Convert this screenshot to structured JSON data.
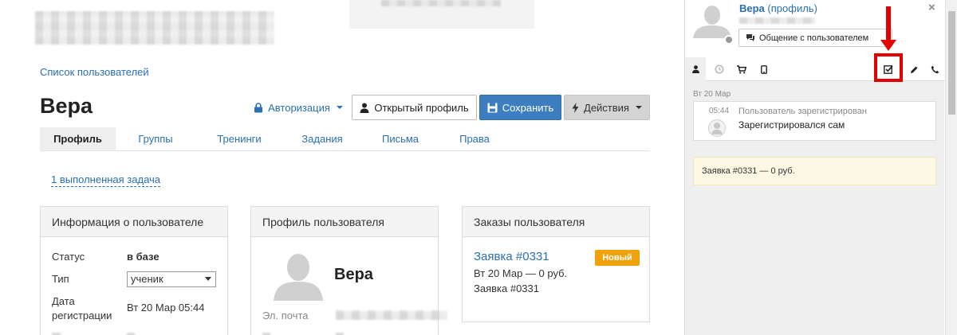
{
  "main": {
    "breadcrumb": "Список пользователей",
    "title": "Вера",
    "auth_button": "Авторизация",
    "open_profile_button": "Открытый профиль",
    "save_button": "Сохранить",
    "actions_button": "Действия",
    "tabs": [
      {
        "label": "Профиль",
        "active": true
      },
      {
        "label": "Группы",
        "active": false
      },
      {
        "label": "Тренинги",
        "active": false
      },
      {
        "label": "Задания",
        "active": false
      },
      {
        "label": "Письма",
        "active": false
      },
      {
        "label": "Права",
        "active": false
      }
    ],
    "tasks_link": "1 выполненная задача"
  },
  "info_panel": {
    "title": "Информация о пользователе",
    "status_label": "Статус",
    "status_value": "в базе",
    "type_label": "Тип",
    "type_value": "ученик",
    "regdate_label_1": "Дата",
    "regdate_label_2": "регистрации",
    "regdate_value": "Вт 20 Мар 05:44"
  },
  "profile_panel": {
    "title": "Профиль пользователя",
    "name": "Вера",
    "email_label": "Эл. почта"
  },
  "orders_panel": {
    "title": "Заказы пользователя",
    "order_link": "Заявка #0331",
    "badge": "Новый",
    "line1": "Вт 20 Мар — 0 руб.",
    "line2": "Заявка #0331",
    "badge_color": "#f0a10c"
  },
  "side": {
    "name": "Вера",
    "profile_link": "(профиль)",
    "message_button": "Общение с пользователем",
    "close": "×",
    "date_label": "Вт 20 Мар",
    "event_time": "05:44",
    "event_title": "Пользователь зарегистрирован",
    "event_desc": "Зарегистрировался сам",
    "order_card": "Заявка #0331 — 0 руб.",
    "highlight_color": "#e50000",
    "tab_icons": [
      "user-icon",
      "history-icon",
      "cart-icon",
      "mobile-icon",
      "checkbox-icon",
      "pencil-icon",
      "phone-icon"
    ]
  },
  "colors": {
    "link": "#2a6fb0",
    "save": "#3d7ec0"
  }
}
